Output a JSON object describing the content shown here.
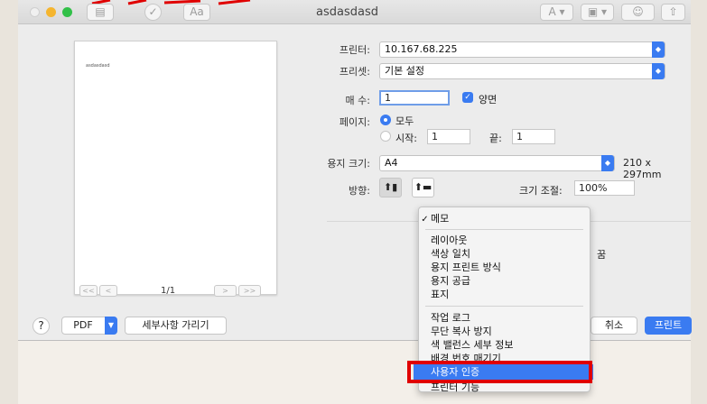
{
  "window": {
    "title": "asdasdasd",
    "toolbar_text_button": "Aa",
    "toolbar_icons": [
      "sidebar-icon",
      "markup-icon",
      "font-icon",
      "text-format-icon",
      "image-format-icon",
      "account-icon",
      "share-icon"
    ]
  },
  "preview": {
    "doc_text": "asdasdasd",
    "page_indicator": "1/1",
    "nav_first": "<<",
    "nav_prev": "<",
    "nav_next": ">",
    "nav_last": ">>"
  },
  "form": {
    "printer_label": "프린터:",
    "printer_value": "10.167.68.225",
    "preset_label": "프리셋:",
    "preset_value": "기본 설정",
    "copies_label": "매 수:",
    "copies_value": "1",
    "duplex_label": "양면",
    "pages_label": "페이지:",
    "pages_all": "모두",
    "pages_from_label": "시작:",
    "pages_from_value": "1",
    "pages_to_label": "끝:",
    "pages_to_value": "1",
    "paper_label": "용지 크기:",
    "paper_value": "A4",
    "paper_dims": "210 x 297mm",
    "orientation_label": "방향:",
    "scale_label": "크기 조절:",
    "scale_value": "100%",
    "partial_text": "꿈"
  },
  "menu": {
    "selected": "메모",
    "items_group1": [
      "레이아웃",
      "색상 일치",
      "용지 프린트 방식",
      "용지 공급",
      "표지"
    ],
    "items_group2": [
      "작업 로그",
      "무단 복사 방지",
      "색 밸런스 세부 정보",
      "배경 번호 매기기"
    ],
    "active_item": "사용자 인증",
    "last_item": "프린터 기능"
  },
  "buttons": {
    "help": "?",
    "pdf": "PDF",
    "details": "세부사항 가리기",
    "cancel": "취소",
    "print": "프린트"
  },
  "colors": {
    "accent": "#3a7bf1",
    "highlight_border": "#e00000"
  }
}
